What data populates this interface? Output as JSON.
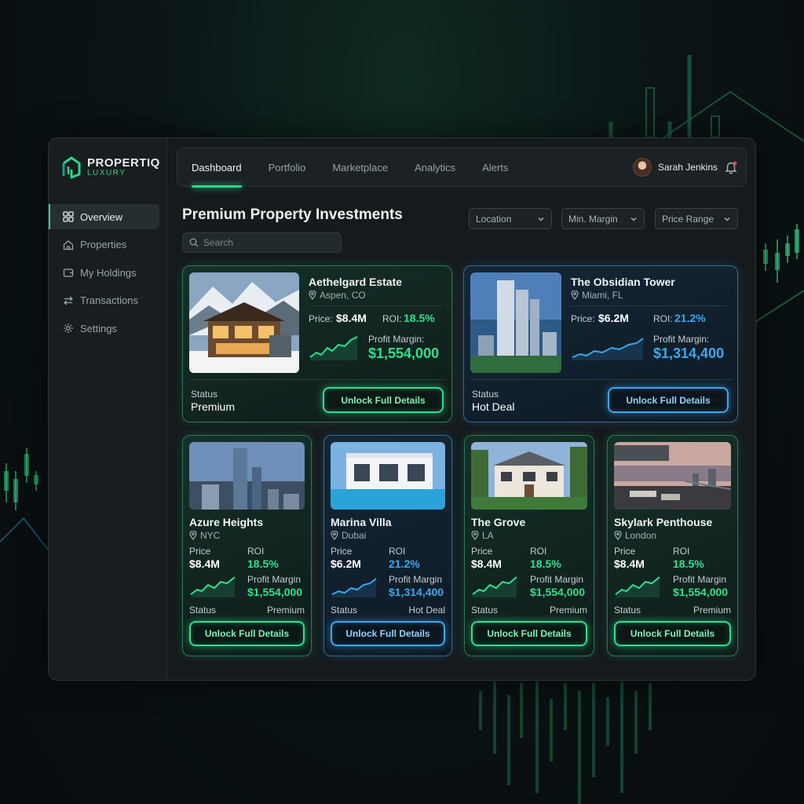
{
  "brand": {
    "name": "PROPERTIQ",
    "tagline": "LUXURY",
    "accent": "#2fd48a",
    "accent_blue": "#3aa8f0"
  },
  "sidebar": {
    "items": [
      {
        "label": "Overview",
        "icon": "grid-icon",
        "active": true
      },
      {
        "label": "Properties",
        "icon": "home-icon"
      },
      {
        "label": "My Holdings",
        "icon": "wallet-icon"
      },
      {
        "label": "Transactions",
        "icon": "arrows-swap-icon"
      },
      {
        "label": "Settings",
        "icon": "gear-icon"
      }
    ]
  },
  "topbar": {
    "tabs": [
      {
        "label": "Dashboard",
        "active": true
      },
      {
        "label": "Portfolio"
      },
      {
        "label": "Marketplace"
      },
      {
        "label": "Analytics"
      },
      {
        "label": "Alerts"
      }
    ],
    "user_name": "Sarah Jenkins",
    "notification_icon": "bell-icon"
  },
  "main": {
    "title": "Premium Property Investments",
    "search_placeholder": "Search",
    "filters": [
      "Location",
      "Min. Margin",
      "Price Range"
    ]
  },
  "featured": [
    {
      "name": "Aethelgard Estate",
      "location": "Aspen, CO",
      "price_label": "Price:",
      "price": "$8.4M",
      "roi_label": "ROI:",
      "roi": "18.5%",
      "margin_label": "Profit Margin:",
      "margin": "$1,554,000",
      "status_label": "Status",
      "status": "Premium",
      "button": "Unlock Full Details",
      "theme": "green"
    },
    {
      "name": "The Obsidian Tower",
      "location": "Miami, FL",
      "price_label": "Price:",
      "price": "$6.2M",
      "roi_label": "ROI:",
      "roi": "21.2%",
      "margin_label": "Profit Margin:",
      "margin": "$1,314,400",
      "status_label": "Status",
      "status": "Hot Deal",
      "button": "Unlock Full Details",
      "theme": "blue"
    }
  ],
  "listings": [
    {
      "name": "Azure Heights",
      "location": "NYC",
      "price_label": "Price",
      "price": "$8.4M",
      "roi_label": "ROI",
      "roi": "18.5%",
      "margin_label": "Profit Margin",
      "margin": "$1,554,000",
      "status_label": "Status",
      "status": "Premium",
      "button": "Unlock Full Details",
      "theme": "green"
    },
    {
      "name": "Marina Villa",
      "location": "Dubai",
      "price_label": "Price",
      "price": "$6.2M",
      "roi_label": "ROI",
      "roi": "21.2%",
      "margin_label": "Profit Margin",
      "margin": "$1,314,400",
      "status_label": "Status",
      "status": "Hot Deal",
      "button": "Unlock Full Details",
      "theme": "blue"
    },
    {
      "name": "The Grove",
      "location": "LA",
      "price_label": "Price",
      "price": "$8.4M",
      "roi_label": "ROI",
      "roi": "18.5%",
      "margin_label": "Profit Margin",
      "margin": "$1,554,000",
      "status_label": "Status",
      "status": "Premium",
      "button": "Unlock Full Details",
      "theme": "green"
    },
    {
      "name": "Skylark Penthouse",
      "location": "London",
      "price_label": "Price",
      "price": "$8.4M",
      "roi_label": "ROI",
      "roi": "18.5%",
      "margin_label": "Profit Margin",
      "margin": "$1,554,000",
      "status_label": "Status",
      "status": "Premium",
      "button": "Unlock Full Details",
      "theme": "green"
    }
  ]
}
